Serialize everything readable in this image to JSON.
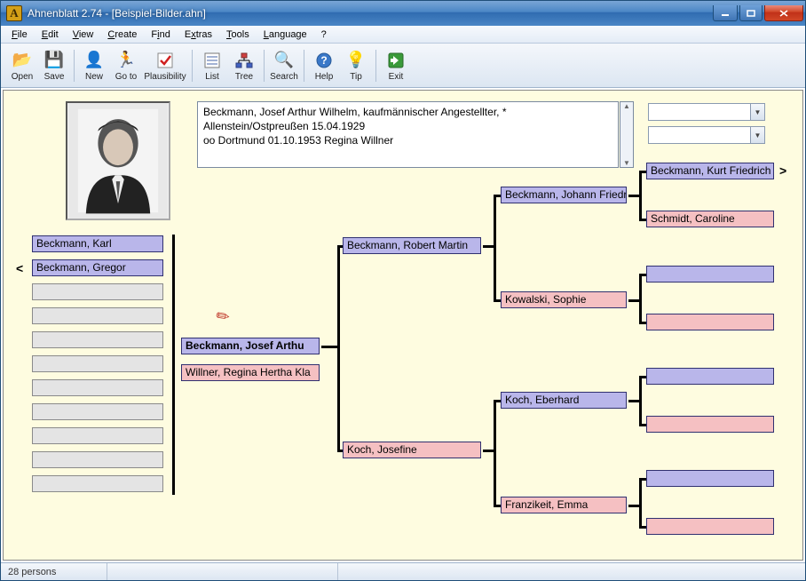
{
  "window": {
    "title": "Ahnenblatt 2.74 - [Beispiel-Bilder.ahn]",
    "app_icon_glyph": "A"
  },
  "menu": {
    "file": "File",
    "edit": "Edit",
    "view": "View",
    "create": "Create",
    "find": "Find",
    "extras": "Extras",
    "tools": "Tools",
    "language": "Language",
    "help": "?"
  },
  "toolbar": {
    "open": "Open",
    "save": "Save",
    "new": "New",
    "goto": "Go to",
    "plausibility": "Plausibility",
    "list": "List",
    "tree": "Tree",
    "search": "Search",
    "help": "Help",
    "tip": "Tip",
    "exit": "Exit"
  },
  "detail": {
    "text": "Beckmann, Josef Arthur Wilhelm, kaufmännischer Angestellter, *\nAllenstein/Ostpreußen 15.04.1929\noo Dortmund 01.10.1953 Regina Willner"
  },
  "siblings": {
    "s0": "Beckmann, Karl",
    "s1": "Beckmann, Gregor"
  },
  "tree": {
    "focus": "Beckmann, Josef Arthu",
    "spouse": "Willner, Regina Hertha Kla",
    "father": "Beckmann, Robert Martin",
    "mother": "Koch, Josefine",
    "pgf": "Beckmann, Johann Friedr",
    "pgm": "Kowalski, Sophie",
    "mgf": "Koch, Eberhard",
    "mgm": "Franzikeit, Emma",
    "ggf1": "Beckmann, Kurt Friedrich",
    "ggm1": "Schmidt, Caroline"
  },
  "nav": {
    "left": "<",
    "right": ">"
  },
  "status": {
    "persons": "28 persons"
  }
}
